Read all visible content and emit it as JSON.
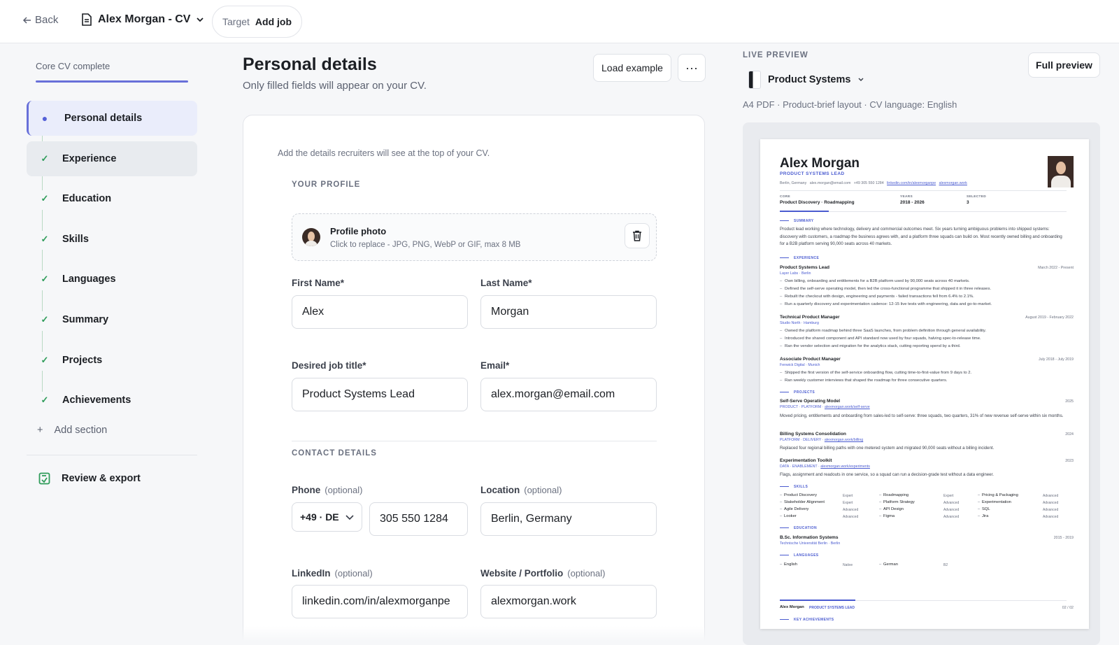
{
  "topbar": {
    "back_label": "Back",
    "doc_name": "Alex Morgan - CV",
    "target_label": "Target",
    "target_value": "Add job"
  },
  "sidebar": {
    "progress_label": "Core CV complete",
    "progress_value": 1.0,
    "items": [
      {
        "label": "Personal details",
        "state": "active"
      },
      {
        "label": "Experience",
        "state": "done"
      },
      {
        "label": "Education",
        "state": "done"
      },
      {
        "label": "Skills",
        "state": "done"
      },
      {
        "label": "Languages",
        "state": "done"
      },
      {
        "label": "Summary",
        "state": "done"
      },
      {
        "label": "Projects",
        "state": "done"
      },
      {
        "label": "Achievements",
        "state": "done"
      }
    ],
    "add_section": "Add section",
    "review_export": "Review & export"
  },
  "main": {
    "title": "Personal details",
    "subtitle": "Only filled fields will appear on your CV.",
    "load_example": "Load example",
    "more": "···",
    "intro": "Add the details recruiters will see at the top of your CV.",
    "profile_section": "YOUR PROFILE",
    "photo": {
      "title": "Profile photo",
      "hint": "Click to replace - JPG, PNG, WebP or GIF, max 8 MB"
    },
    "fields": {
      "first_name": {
        "label": "First Name*",
        "value": "Alex"
      },
      "last_name": {
        "label": "Last Name*",
        "value": "Morgan"
      },
      "job_title": {
        "label": "Desired job title*",
        "value": "Product Systems Lead"
      },
      "email": {
        "label": "Email*",
        "value": "alex.morgan@email.com"
      }
    },
    "contact_section": "CONTACT DETAILS",
    "optional": "(optional)",
    "phone": {
      "label": "Phone",
      "country": "+49 · DE",
      "value": "305 550 1284"
    },
    "location": {
      "label": "Location",
      "value": "Berlin, Germany"
    },
    "linkedin": {
      "label": "LinkedIn",
      "value": "linkedin.com/in/alexmorganpe"
    },
    "website": {
      "label": "Website / Portfolio",
      "value": "alexmorgan.work"
    }
  },
  "preview": {
    "label": "LIVE PREVIEW",
    "template": "Product Systems",
    "meta": "A4 PDF · Product-brief layout · CV language: English",
    "full_preview": "Full preview",
    "cv": {
      "name": "Alex Morgan",
      "role": "PRODUCT SYSTEMS LEAD",
      "contact": [
        "Berlin, Germany",
        "alex.morgan@email.com",
        "+49 305 550 1284",
        "linkedin.com/in/alexmorganpe",
        "alexmorgan.work"
      ],
      "core_k": "CORE",
      "core_v": "Product Discovery · Roadmapping",
      "years_k": "YEARS",
      "years_v": "2018 - 2026",
      "selected_k": "SELECTED",
      "selected_v": "3",
      "summary_h": "SUMMARY",
      "summary": "Product lead working where technology, delivery and commercial outcomes meet. Six years turning ambiguous problems into shipped systems: discovery with customers, a roadmap the business agrees with, and a platform three squads can build on. Most recently owned billing and onboarding for a B2B platform serving 90,000 seats across 40 markets.",
      "experience_h": "EXPERIENCE",
      "jobs": [
        {
          "title": "Product Systems Lead",
          "company": "Layer Labs",
          "city": "Berlin",
          "dates": "March 2022 - Present",
          "bullets": [
            "Own billing, onboarding and entitlements for a B2B platform used by 90,000 seats across 40 markets.",
            "Defined the self-serve operating model, then led the cross-functional programme that shipped it in three releases.",
            "Rebuilt the checkout with design, engineering and payments - failed transactions fell from 6.4% to 2.1%.",
            "Run a quarterly discovery and experimentation cadence: 12-15 live tests with engineering, data and go-to-market."
          ]
        },
        {
          "title": "Technical Product Manager",
          "company": "Studio North",
          "city": "Hamburg",
          "dates": "August 2019 - February 2022",
          "bullets": [
            "Owned the platform roadmap behind three SaaS launches, from problem definition through general availability.",
            "Introduced the shared component and API standard now used by four squads, halving spec-to-release time.",
            "Ran the vendor selection and migration for the analytics stack, cutting reporting spend by a third."
          ]
        },
        {
          "title": "Associate Product Manager",
          "company": "Fenwick Digital",
          "city": "Munich",
          "dates": "July 2018 - July 2019",
          "bullets": [
            "Shipped the first version of the self-service onboarding flow, cutting time-to-first-value from 9 days to 2.",
            "Ran weekly customer interviews that shaped the roadmap for three consecutive quarters."
          ]
        }
      ],
      "projects_h": "PROJECTS",
      "projects": [
        {
          "title": "Self-Serve Operating Model",
          "tag": "PRODUCT · PLATFORM",
          "link": "alexmorgan.work/self-serve",
          "year": "2025",
          "text": "Moved pricing, entitlements and onboarding from sales-led to self-serve: three squads, two quarters, 31% of new revenue self-serve within six months."
        },
        {
          "title": "Billing Systems Consolidation",
          "tag": "PLATFORM · DELIVERY",
          "link": "alexmorgan.work/billing",
          "year": "2024",
          "text": "Replaced four regional billing paths with one metered system and migrated 90,000 seats without a billing incident."
        },
        {
          "title": "Experimentation Toolkit",
          "tag": "DATA · ENABLEMENT",
          "link": "alexmorgan.work/experiments",
          "year": "2023",
          "text": "Flags, assignment and readouts in one service, so a squad can run a decision-grade test without a data engineer."
        }
      ],
      "skills_h": "SKILLS",
      "skills": [
        [
          {
            "n": "Product Discovery",
            "l": "Expert"
          },
          {
            "n": "Roadmapping",
            "l": "Expert"
          },
          {
            "n": "Pricing & Packaging",
            "l": "Advanced"
          }
        ],
        [
          {
            "n": "Stakeholder Alignment",
            "l": "Expert"
          },
          {
            "n": "Platform Strategy",
            "l": "Advanced"
          },
          {
            "n": "Experimentation",
            "l": "Advanced"
          }
        ],
        [
          {
            "n": "Agile Delivery",
            "l": "Advanced"
          },
          {
            "n": "API Design",
            "l": "Advanced"
          },
          {
            "n": "SQL",
            "l": "Advanced"
          }
        ],
        [
          {
            "n": "Looker",
            "l": "Advanced"
          },
          {
            "n": "Figma",
            "l": "Advanced"
          },
          {
            "n": "Jira",
            "l": "Advanced"
          }
        ]
      ],
      "education_h": "EDUCATION",
      "degree": "B.Sc. Information Systems",
      "school": "Technische Universität Berlin",
      "school_city": "Berlin",
      "edu_dates": "2015 - 2019",
      "languages_h": "LANGUAGES",
      "languages": [
        {
          "n": "English",
          "l": "Native"
        },
        {
          "n": "German",
          "l": "B2"
        }
      ],
      "footer_name": "Alex Morgan",
      "footer_role": "PRODUCT SYSTEMS LEAD",
      "footer_page": "02 / 02",
      "footer_next": "KEY ACHIEVEMENTS"
    }
  },
  "colors": {
    "accent": "#6870d9",
    "check": "#2f9c5a",
    "cv_accent": "#4a5bd0"
  },
  "icons": [
    "arrow-left-icon",
    "document-icon",
    "chevron-down-icon",
    "check-icon",
    "plus-icon",
    "export-icon",
    "trash-icon",
    "more-icon"
  ]
}
